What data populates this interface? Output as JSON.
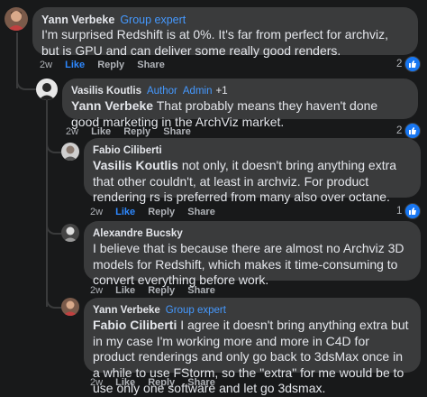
{
  "comments": [
    {
      "author": "Yann Verbeke",
      "badge": "Group expert",
      "text": "I'm surprised Redshift is at 0%. It's far from perfect for archviz, but is GPU and can deliver some really good renders.",
      "time": "2w",
      "actions": [
        "Like",
        "Reply",
        "Share"
      ],
      "reactions": "2"
    },
    {
      "author": "Vasilis Koutlis",
      "badges": [
        "Author",
        "Admin"
      ],
      "badge_extra": "+1",
      "mention": "Yann Verbeke",
      "text": " That probably means they haven't done good marketing in the ArchViz market.",
      "time": "2w",
      "actions": [
        "Like",
        "Reply",
        "Share"
      ],
      "reactions": "2"
    },
    {
      "author": "Fabio Ciliberti",
      "mention": "Vasilis Koutlis",
      "text": " not only, it doesn't bring anything extra that other couldn't, at least in archviz. For product rendering rs is preferred from many also over octane.",
      "time": "2w",
      "actions": [
        "Like",
        "Reply",
        "Share"
      ],
      "reactions": "1"
    },
    {
      "author": "Alexandre Bucsky",
      "text": "I believe that is because there are almost no Archviz 3D models for Redshift, which makes it time-consuming to convert everything before work.",
      "time": "2w",
      "actions": [
        "Like",
        "Reply",
        "Share"
      ]
    },
    {
      "author": "Yann Verbeke",
      "badge": "Group expert",
      "mention": "Fabio Ciliberti",
      "text": " I agree it doesn't bring anything extra but in my case I'm working more and more in C4D for product renderings and only go back to 3dsMax once in a while to use FStorm, so the \"extra\" for me would be to use only one software and let go 3dsmax.",
      "time": "2w",
      "actions": [
        "Like",
        "Reply",
        "Share"
      ]
    }
  ],
  "colors": {
    "background": "#18191a",
    "bubble": "#3a3b3c",
    "badge_blue": "#4599ff",
    "liked_blue": "#2d88ff",
    "muted": "#b0b3b8"
  },
  "icons": [
    "like-thumb-icon",
    "avatar"
  ]
}
